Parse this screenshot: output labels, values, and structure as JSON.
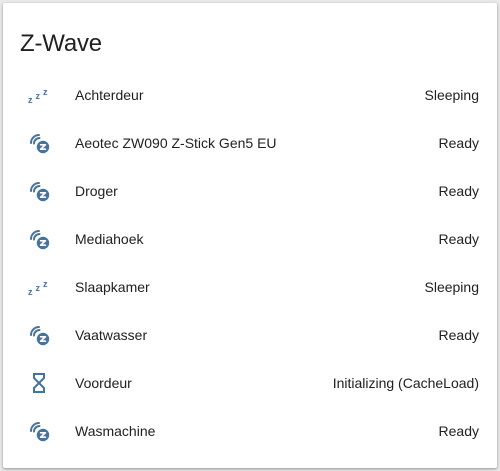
{
  "card": {
    "title": "Z-Wave"
  },
  "accent_color": "#44739e",
  "devices": [
    {
      "name": "Achterdeur",
      "state": "Sleeping",
      "icon": "sleep-icon"
    },
    {
      "name": "Aeotec ZW090 Z-Stick Gen5 EU",
      "state": "Ready",
      "icon": "z-wave-icon"
    },
    {
      "name": "Droger",
      "state": "Ready",
      "icon": "z-wave-icon"
    },
    {
      "name": "Mediahoek",
      "state": "Ready",
      "icon": "z-wave-icon"
    },
    {
      "name": "Slaapkamer",
      "state": "Sleeping",
      "icon": "sleep-icon"
    },
    {
      "name": "Vaatwasser",
      "state": "Ready",
      "icon": "z-wave-icon"
    },
    {
      "name": "Voordeur",
      "state": "Initializing (CacheLoad)",
      "icon": "hourglass-icon"
    },
    {
      "name": "Wasmachine",
      "state": "Ready",
      "icon": "z-wave-icon"
    }
  ]
}
